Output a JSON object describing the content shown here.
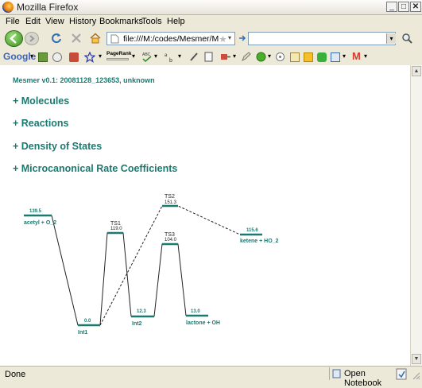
{
  "window": {
    "title": "Mozilla Firefox",
    "minimize": "_",
    "maximize": "□",
    "close": "✕"
  },
  "menu": [
    {
      "label": "File"
    },
    {
      "label": "Edit"
    },
    {
      "label": "View"
    },
    {
      "label": "History"
    },
    {
      "label": "Bookmarks"
    },
    {
      "label": "Tools"
    },
    {
      "label": "Help"
    }
  ],
  "nav": {
    "url": "file:///M:/codes/Mesmer/Me",
    "search_value": ""
  },
  "toolbar": {
    "google": "Google",
    "pagerank": "PageRank"
  },
  "page": {
    "version": "Mesmer v0.1: 20081128_123653, unknown",
    "sections": [
      {
        "label": "+ Molecules"
      },
      {
        "label": "+ Reactions"
      },
      {
        "label": "+ Density of States"
      },
      {
        "label": "+ Microcanonical Rate Coefficients"
      }
    ]
  },
  "diagram": {
    "species": [
      {
        "name": "acetyl + O_2",
        "energy": "139.5"
      },
      {
        "name": "TS1",
        "energy": "119.0"
      },
      {
        "name": "Int1",
        "energy": "0.0"
      },
      {
        "name": "TS2",
        "energy": "151.3"
      },
      {
        "name": "Int2",
        "energy": "12.3"
      },
      {
        "name": "TS3",
        "energy": "104.0"
      },
      {
        "name": "lactone + OH",
        "energy": "13.0"
      },
      {
        "name": "ketene + HO_2",
        "energy": "115.6"
      }
    ],
    "colors": {
      "level": "#1a7a70",
      "line": "#222222"
    }
  },
  "status": {
    "text": "Done",
    "notebook": "Open Notebook"
  }
}
